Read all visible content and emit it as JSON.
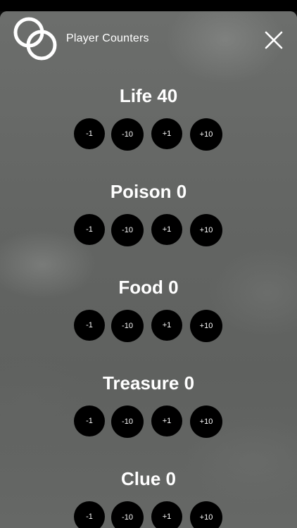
{
  "header": {
    "title": "Player Counters",
    "logo_icon": "double-circle-logo-icon",
    "close_icon": "close-icon"
  },
  "counters": [
    {
      "label": "Life 40",
      "buttons": [
        "-1",
        "-10",
        "+1",
        "+10"
      ]
    },
    {
      "label": "Poison 0",
      "buttons": [
        "-1",
        "-10",
        "+1",
        "+10"
      ]
    },
    {
      "label": "Food 0",
      "buttons": [
        "-1",
        "-10",
        "+1",
        "+10"
      ]
    },
    {
      "label": "Treasure 0",
      "buttons": [
        "-1",
        "-10",
        "+1",
        "+10"
      ]
    },
    {
      "label": "Clue 0",
      "buttons": [
        "-1",
        "-10",
        "+1",
        "+10"
      ]
    }
  ],
  "colors": {
    "button_bg": "#000000",
    "text": "#ffffff",
    "sheet_bg": "#666866"
  }
}
